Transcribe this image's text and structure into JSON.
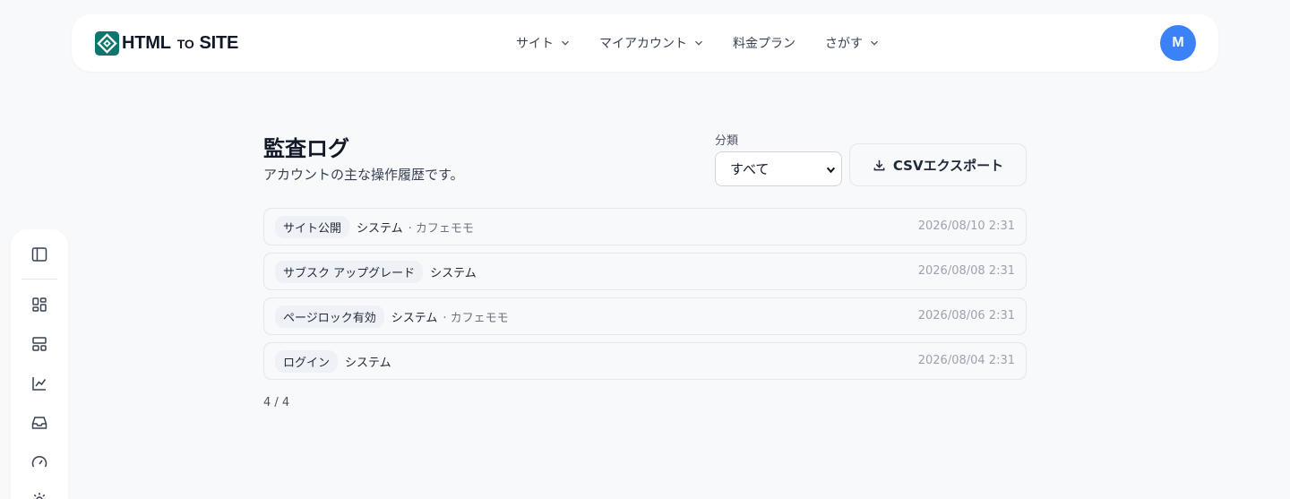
{
  "header": {
    "logo": {
      "main": "HTML",
      "small": "TO",
      "end": "SITE"
    },
    "nav": [
      {
        "label": "サイト",
        "has_menu": true
      },
      {
        "label": "マイアカウント",
        "has_menu": true
      },
      {
        "label": "料金プラン",
        "has_menu": false
      },
      {
        "label": "さがす",
        "has_menu": true
      }
    ],
    "avatar_initial": "M"
  },
  "sidebar": {
    "icons": [
      "sidebar-toggle-icon",
      "dashboard-icon",
      "layout-icon",
      "chart-icon",
      "inbox-icon",
      "gauge-icon",
      "settings-icon"
    ]
  },
  "main": {
    "title": "監査ログ",
    "subtitle": "アカウントの主な操作履歴です。",
    "filter": {
      "label": "分類",
      "selected": "すべて"
    },
    "export_label": "CSVエクスポート",
    "logs": [
      {
        "action": "サイト公開",
        "actor": "システム",
        "target": "· カフェモモ",
        "time": "2026/08/10 2:31"
      },
      {
        "action": "サブスク アップグレード",
        "actor": "システム",
        "target": "",
        "time": "2026/08/08 2:31"
      },
      {
        "action": "ページロック有効",
        "actor": "システム",
        "target": "· カフェモモ",
        "time": "2026/08/06 2:31"
      },
      {
        "action": "ログイン",
        "actor": "システム",
        "target": "",
        "time": "2026/08/04 2:31"
      }
    ],
    "count": "4 / 4"
  },
  "colors": {
    "accent": "#3b82f6",
    "logo": "#0f766e",
    "background": "#f8f9fb"
  }
}
